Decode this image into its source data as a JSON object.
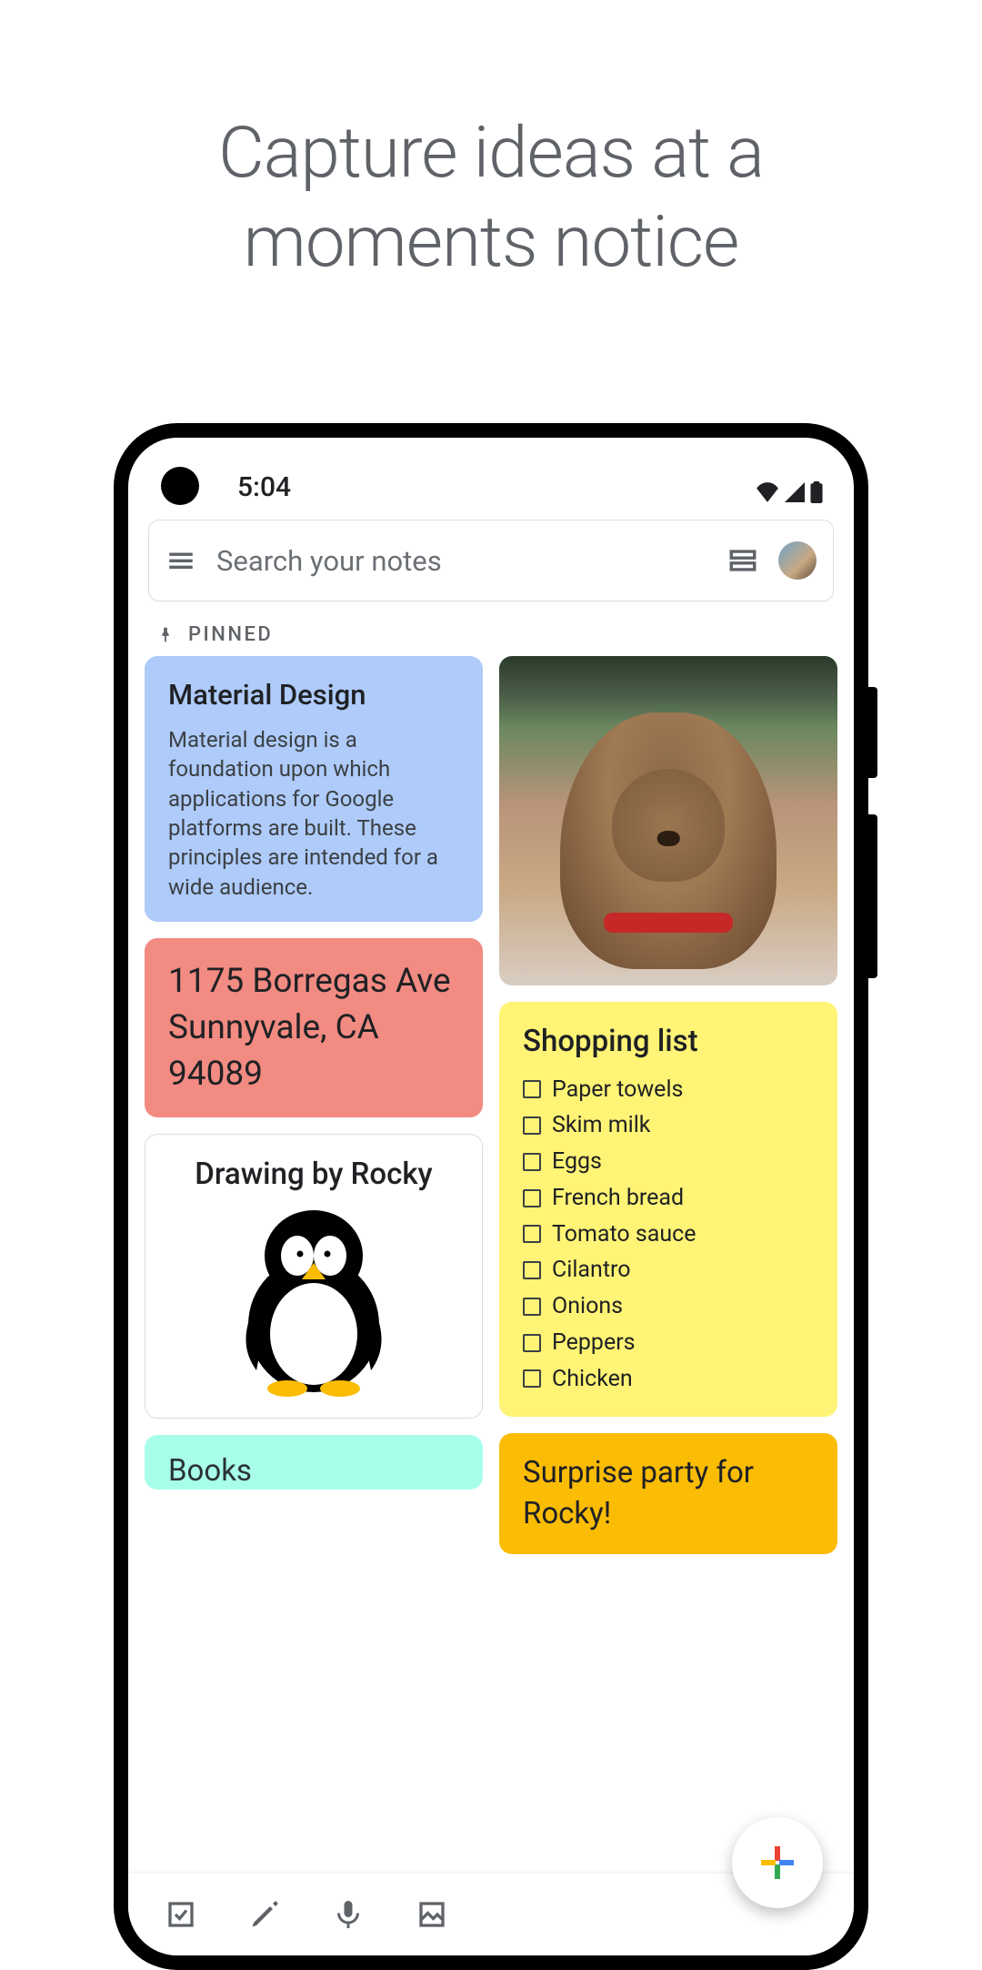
{
  "promo": {
    "headline": "Capture ideas at a moments notice"
  },
  "status": {
    "time": "5:04"
  },
  "search": {
    "placeholder": "Search your notes",
    "menu_icon": "menu-icon",
    "view_icon": "grid-view-icon"
  },
  "section": {
    "pinned_label": "PINNED"
  },
  "notes": {
    "material": {
      "title": "Material Design",
      "body": "Material design is a foundation upon which applications for Google platforms are built. These principles are intended for a wide audience.",
      "color": "#aecbfa"
    },
    "address": {
      "text": "1175 Borregas Ave Sunnyvale, CA 94089",
      "color": "#f28b82"
    },
    "drawing": {
      "title": "Drawing by Rocky",
      "color": "#ffffff"
    },
    "books": {
      "title": "Books",
      "color": "#a7ffeb"
    },
    "image_note": {
      "alt": "Photo of a tan wrinkly dog on a leash outdoors"
    },
    "shopping": {
      "title": "Shopping list",
      "color": "#fff475",
      "items": [
        "Paper towels",
        "Skim milk",
        "Eggs",
        "French bread",
        "Tomato sauce",
        "Cilantro",
        "Onions",
        "Peppers",
        "Chicken"
      ]
    },
    "party": {
      "title": "Surprise party for Rocky!",
      "color": "#fbbc04"
    }
  },
  "bottom_bar": {
    "checkbox_icon": "new-list",
    "brush_icon": "new-drawing",
    "mic_icon": "new-audio",
    "image_icon": "new-image"
  },
  "fab": {
    "label": "Create note",
    "colors": {
      "red": "#ea4335",
      "blue": "#4285f4",
      "green": "#34a853",
      "yellow": "#fbbc04"
    }
  }
}
